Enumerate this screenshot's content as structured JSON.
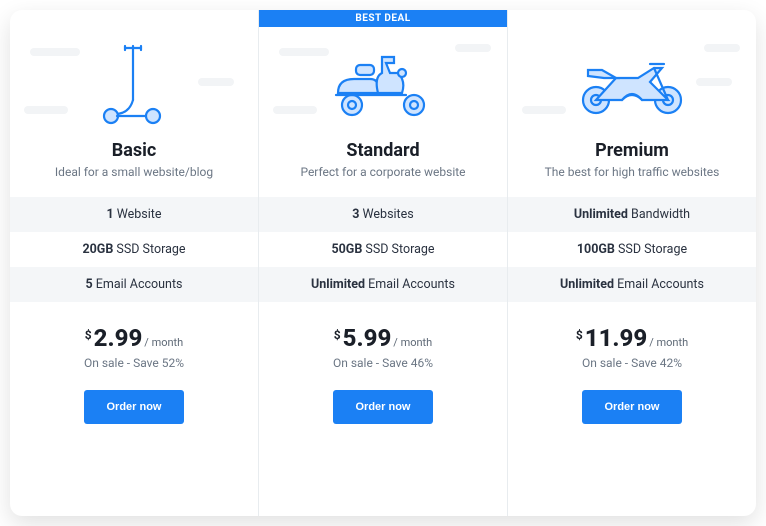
{
  "plans": [
    {
      "title": "Basic",
      "subtitle": "Ideal for a small website/blog",
      "badge": null,
      "features": [
        {
          "bold": "1",
          "rest": " Website"
        },
        {
          "bold": "20GB",
          "rest": " SSD Storage"
        },
        {
          "bold": "5",
          "rest": " Email Accounts"
        }
      ],
      "currency": "$",
      "price": "2.99",
      "period": "/ month",
      "sale": "On sale - Save 52%",
      "cta": "Order now",
      "icon": "scooter"
    },
    {
      "title": "Standard",
      "subtitle": "Perfect for a corporate website",
      "badge": "BEST DEAL",
      "features": [
        {
          "bold": "3",
          "rest": " Websites"
        },
        {
          "bold": "50GB",
          "rest": " SSD Storage"
        },
        {
          "bold": "Unlimited",
          "rest": " Email Accounts"
        }
      ],
      "currency": "$",
      "price": "5.99",
      "period": "/ month",
      "sale": "On sale - Save 46%",
      "cta": "Order now",
      "icon": "moped"
    },
    {
      "title": "Premium",
      "subtitle": "The best for high traffic websites",
      "badge": null,
      "features": [
        {
          "bold": "Unlimited",
          "rest": " Bandwidth"
        },
        {
          "bold": "100GB",
          "rest": " SSD Storage"
        },
        {
          "bold": "Unlimited",
          "rest": " Email Accounts"
        }
      ],
      "currency": "$",
      "price": "11.99",
      "period": "/ month",
      "sale": "On sale - Save 42%",
      "cta": "Order now",
      "icon": "motorcycle"
    }
  ]
}
